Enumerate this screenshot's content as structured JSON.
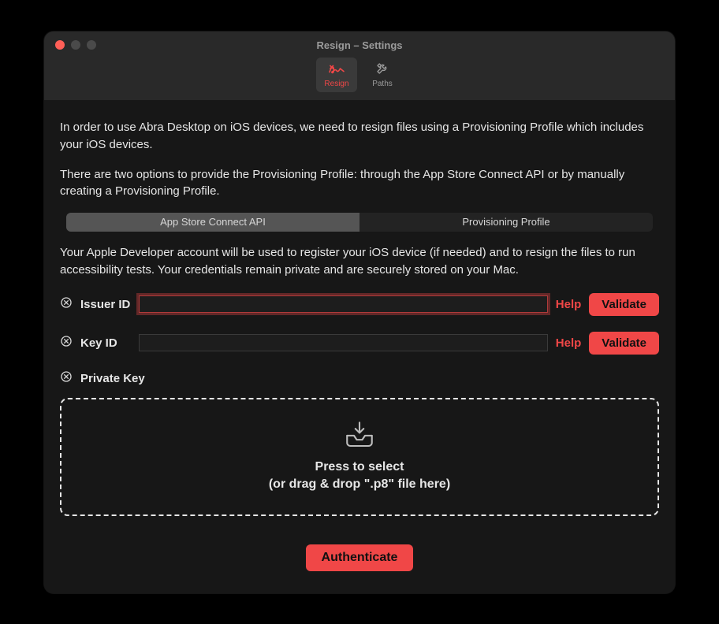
{
  "window": {
    "title": "Resign – Settings"
  },
  "toolbar": {
    "tabs": [
      {
        "label": "Resign",
        "active": true
      },
      {
        "label": "Paths",
        "active": false
      }
    ]
  },
  "intro": {
    "p1": "In order to use Abra Desktop on iOS devices, we need to resign files using a Provisioning Profile which includes your iOS devices.",
    "p2": "There are two options to provide the Provisioning Profile: through the App Store Connect API or by manually creating a Provisioning Profile."
  },
  "segments": {
    "items": [
      {
        "label": "App Store Connect API",
        "active": true
      },
      {
        "label": "Provisioning Profile",
        "active": false
      }
    ]
  },
  "description": "Your Apple Developer account will be used to register your iOS device (if needed) and to resign the files to run accessibility tests. Your credentials remain private and are securely stored on your Mac.",
  "fields": {
    "issuerId": {
      "label": "Issuer ID",
      "value": "",
      "help": "Help",
      "validate": "Validate",
      "statusIcon": "error-circle-icon"
    },
    "keyId": {
      "label": "Key ID",
      "value": "",
      "help": "Help",
      "validate": "Validate",
      "statusIcon": "error-circle-icon"
    },
    "privateKey": {
      "label": "Private Key",
      "statusIcon": "error-circle-icon"
    }
  },
  "dropzone": {
    "line1": "Press to select",
    "line2": "(or drag & drop \".p8\" file here)"
  },
  "actions": {
    "authenticate": "Authenticate"
  },
  "colors": {
    "accent": "#f04747",
    "windowBg": "#1e1e1e",
    "titlebarBg": "#292929",
    "contentBg": "#171717"
  }
}
